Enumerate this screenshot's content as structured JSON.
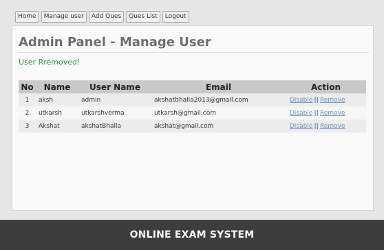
{
  "nav": {
    "items": [
      "Home",
      "Manage user",
      "Add Ques",
      "Ques List",
      "Logout"
    ]
  },
  "panel": {
    "title": "Admin Panel - Manage User",
    "status_message": "User Rremoved!",
    "status_color": "#2e9a2e"
  },
  "table": {
    "headers": [
      "No",
      "Name",
      "User Name",
      "Email",
      "Action"
    ],
    "rows": [
      {
        "no": "1",
        "name": "aksh",
        "username": "admin",
        "email": "akshatbhalla2013@gmail.com",
        "disable": "Disable",
        "separator": "||",
        "remove": "Remove"
      },
      {
        "no": "2",
        "name": "utkarsh",
        "username": "utkarshverma",
        "email": "utkarsh@gmail.com",
        "disable": "Disable",
        "separator": "||",
        "remove": "Remove"
      },
      {
        "no": "3",
        "name": "Akshat",
        "username": "akshatBhalla",
        "email": "akshat@gmail.com",
        "disable": "Disable",
        "separator": "||",
        "remove": "Remove"
      }
    ]
  },
  "footer": {
    "title": "ONLINE EXAM SYSTEM"
  },
  "colors": {
    "footer_bg": "#3d3d3d",
    "link": "#6a8fc0",
    "header_bg": "#c9c9c9"
  }
}
